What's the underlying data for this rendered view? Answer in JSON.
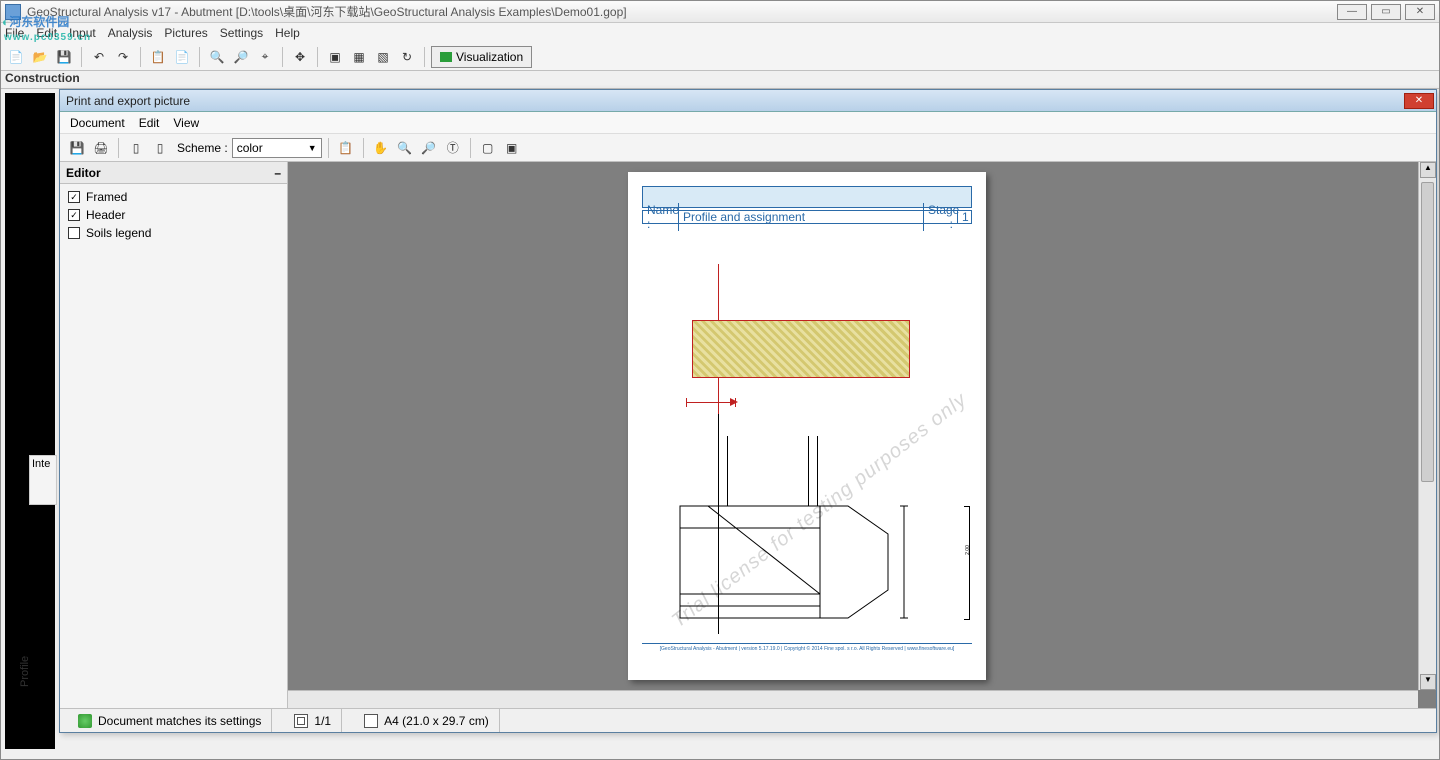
{
  "watermark_logo": {
    "line1": "河东软件园",
    "line2": "www.pc0359.cn"
  },
  "main_window": {
    "title": "GeoStructural Analysis v17 - Abutment [D:\\tools\\桌面\\河东下载站\\GeoStructural Analysis Examples\\Demo01.gop]",
    "menu": [
      "File",
      "Edit",
      "Input",
      "Analysis",
      "Pictures",
      "Settings",
      "Help"
    ],
    "toolbar_visualization": "Visualization",
    "construction_label": "Construction",
    "profile_tab": "Profile",
    "inte_label": "Inte"
  },
  "dialog": {
    "title": "Print and export picture",
    "menu": [
      "Document",
      "Edit",
      "View"
    ],
    "scheme_label": "Scheme :",
    "scheme_value": "color",
    "editor": {
      "title": "Editor",
      "items": [
        {
          "label": "Framed",
          "checked": true
        },
        {
          "label": "Header",
          "checked": true
        },
        {
          "label": "Soils legend",
          "checked": false
        }
      ]
    },
    "status": {
      "settings_match": "Document matches its settings",
      "page_indicator": "1/1",
      "paper_size": "A4 (21.0 x 29.7 cm)"
    }
  },
  "page": {
    "name_label": "Name :",
    "name_value": "Profile and assignment",
    "stage_label": "Stage :",
    "stage_value": "1",
    "dim_height_label": "2.00",
    "footer": "[GeoStructural Analysis - Abutment | version 5.17.19.0 | Copyright © 2014 Fine spol. s r.o. All Rights Reserved | www.finesoftware.eu]",
    "diag_watermark": "Trial license for testing purposes only"
  }
}
